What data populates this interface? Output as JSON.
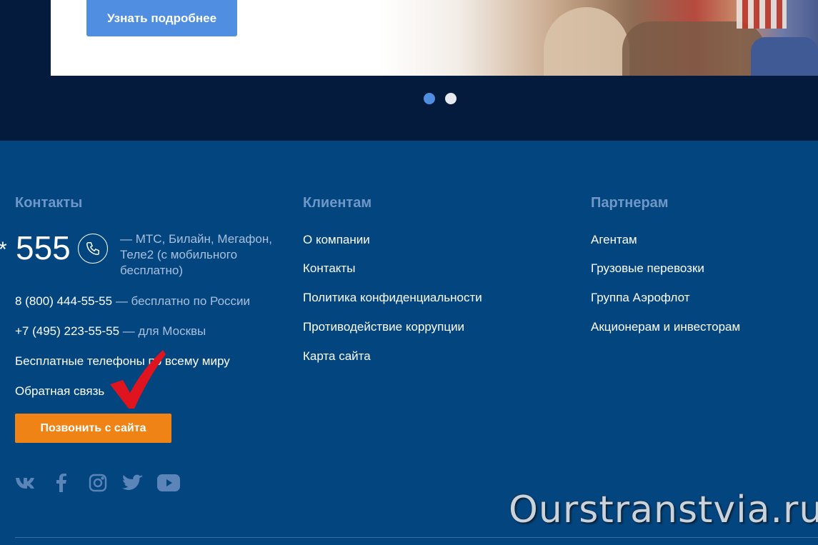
{
  "hero": {
    "cta_label": "Узнать подробнее",
    "slides": 2,
    "active_slide": 1
  },
  "contacts": {
    "heading": "Контакты",
    "star": "*",
    "short_number": "555",
    "operators_text": "— МТС, Билайн, Мегафон, Теле2 (с мобильного бесплатно)",
    "phones": [
      {
        "number": "8 (800) 444-55-55",
        "note": "— бесплатно по России"
      },
      {
        "number": "+7 (495) 223-55-55",
        "note": "— для Москвы"
      }
    ],
    "free_phones_link": "Бесплатные телефоны по всему миру",
    "feedback_link": "Обратная связь",
    "callback_button": "Позвонить с сайта",
    "social_icons": [
      "vk-icon",
      "facebook-icon",
      "instagram-icon",
      "twitter-icon",
      "youtube-icon"
    ]
  },
  "clients": {
    "heading": "Клиентам",
    "links": [
      "О компании",
      "Контакты",
      "Политика конфиденциальности",
      "Противодействие коррупции",
      "Карта сайта"
    ]
  },
  "partners": {
    "heading": "Партнерам",
    "links": [
      "Агентам",
      "Грузовые перевозки",
      "Группа Аэрофлот",
      "Акционерам и инвесторам"
    ]
  },
  "watermark": "Ourstranstvia.ru",
  "colors": {
    "footer_bg": "#02457f",
    "hero_bg": "#051b3d",
    "accent_blue": "#4f8ee0",
    "orange": "#f08315",
    "heading": "#6f97c7"
  }
}
